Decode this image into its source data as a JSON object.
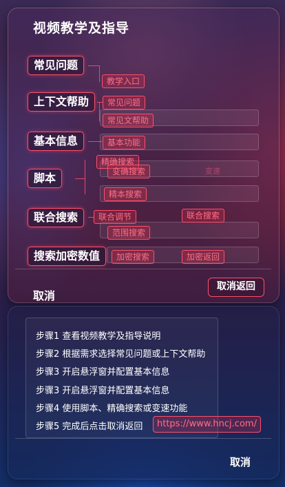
{
  "dialog": {
    "title": "视频教学及指导",
    "menu": [
      {
        "label": "常见问题"
      },
      {
        "label": "上下文帮助"
      },
      {
        "label": "基本信息"
      },
      {
        "label": "脚本"
      },
      {
        "label": "联合搜索"
      },
      {
        "label": "搜索加密数值"
      }
    ],
    "tags": {
      "faq_entry": "教学入口",
      "ctx_faq": "常见问题",
      "ctx_help": "常见文帮助",
      "basic_func": "基本功能",
      "exact_search": "精确搜索",
      "variable_search": "变确搜索",
      "faint_label": "变速",
      "fine_search": "精本搜索",
      "joint_adjust": "联合调节",
      "joint_search": "联合搜索",
      "range_search": "范围搜索",
      "encrypt_search": "加密搜索",
      "encrypt_return": "加密返回"
    },
    "cancel": "取消",
    "cancel_return": "取消返回"
  },
  "steps_panel": {
    "steps": [
      "步骤1 查看视频教学及指导说明",
      "步骤2 根据需求选择常见问题或上下文帮助",
      "步骤3 开启悬浮窗并配置基本信息",
      "步骤3 开启悬浮窗并配置基本信息",
      "步骤4 使用脚本、精确搜索或变速功能",
      "步骤5 完成后点击取消返回"
    ],
    "url": "https://www.hncj.com/",
    "cancel": "取消"
  },
  "colors": {
    "accent": "#ff4f6c",
    "tag_text": "#ff6f84"
  }
}
